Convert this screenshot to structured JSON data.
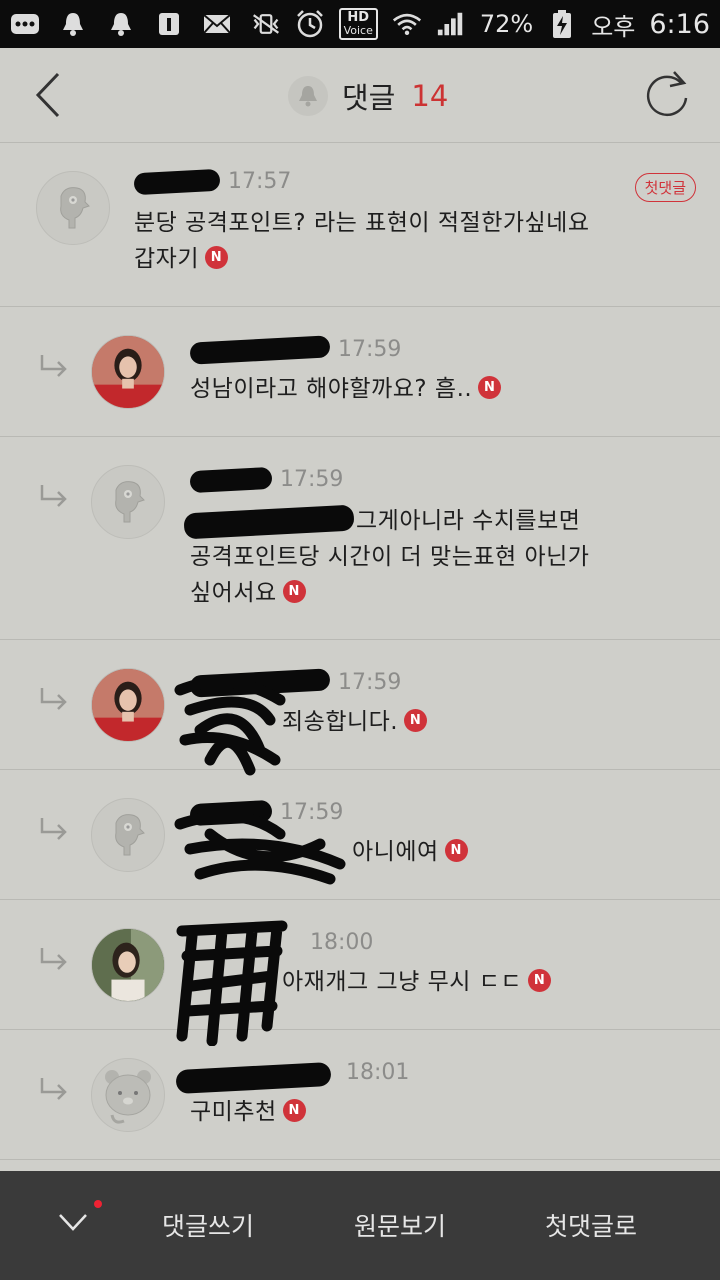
{
  "status_bar": {
    "hd_label": "HD",
    "voice_label": "Voice",
    "battery": "72%",
    "ampm": "오후",
    "time": "6:16"
  },
  "header": {
    "title": "댓글",
    "count": "14"
  },
  "first_comment_badge": "첫댓글",
  "comments": [
    {
      "time": "17:57",
      "text": "분당 공격포인트? 라는 표현이 적절한가싶네요\n갑자기",
      "badge": "N"
    },
    {
      "time": "17:59",
      "text": "성남이라고 해야할까요? 흠..",
      "badge": "N"
    },
    {
      "time": "17:59",
      "text": "그게아니라 수치를보면",
      "text2": "공격포인트당 시간이 더 맞는표현 아닌가",
      "text3": "싶어서요",
      "badge": "N"
    },
    {
      "time": "17:59",
      "text": "죄송합니다.",
      "badge": "N"
    },
    {
      "time": "17:59",
      "text": "아니에여",
      "badge": "N"
    },
    {
      "time": "18:00",
      "text": "아재개그 그냥 무시 ㄷㄷ",
      "badge": "N"
    },
    {
      "time": "18:01",
      "text": "구미추천",
      "badge": "N"
    }
  ],
  "bottom_bar": {
    "write": "댓글쓰기",
    "view_original": "원문보기",
    "to_first": "첫댓글로"
  },
  "colors": {
    "accent": "#d0333a",
    "background": "#cfcfca",
    "bottom_bar": "#3a3a3a"
  }
}
